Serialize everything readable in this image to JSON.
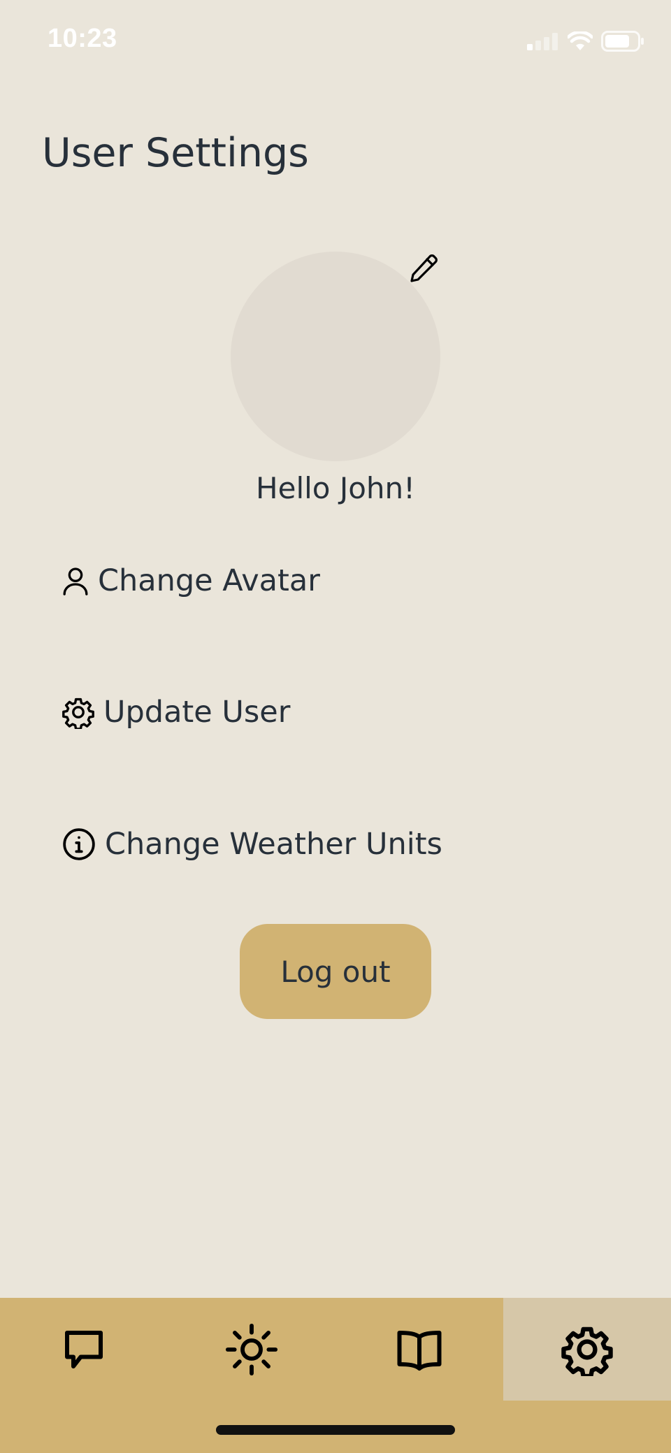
{
  "status_bar": {
    "time": "10:23"
  },
  "page": {
    "title": "User Settings",
    "greeting": "Hello John!"
  },
  "menu": [
    {
      "label": "Change Avatar",
      "icon": "user-icon"
    },
    {
      "label": "Update User",
      "icon": "gear-icon"
    },
    {
      "label": "Change Weather Units",
      "icon": "info-icon"
    }
  ],
  "logout": {
    "label": "Log out"
  },
  "tabs": [
    {
      "name": "chat",
      "icon": "chat-bubble-icon",
      "active": false
    },
    {
      "name": "weather",
      "icon": "sun-icon",
      "active": false
    },
    {
      "name": "journal",
      "icon": "book-icon",
      "active": false
    },
    {
      "name": "settings",
      "icon": "gear-icon",
      "active": true
    }
  ],
  "colors": {
    "background": "#EAE5DA",
    "avatar_placeholder": "#E1DBD1",
    "accent": "#D1B373",
    "active_tab": "#D6C7A8",
    "text": "#27303A"
  }
}
